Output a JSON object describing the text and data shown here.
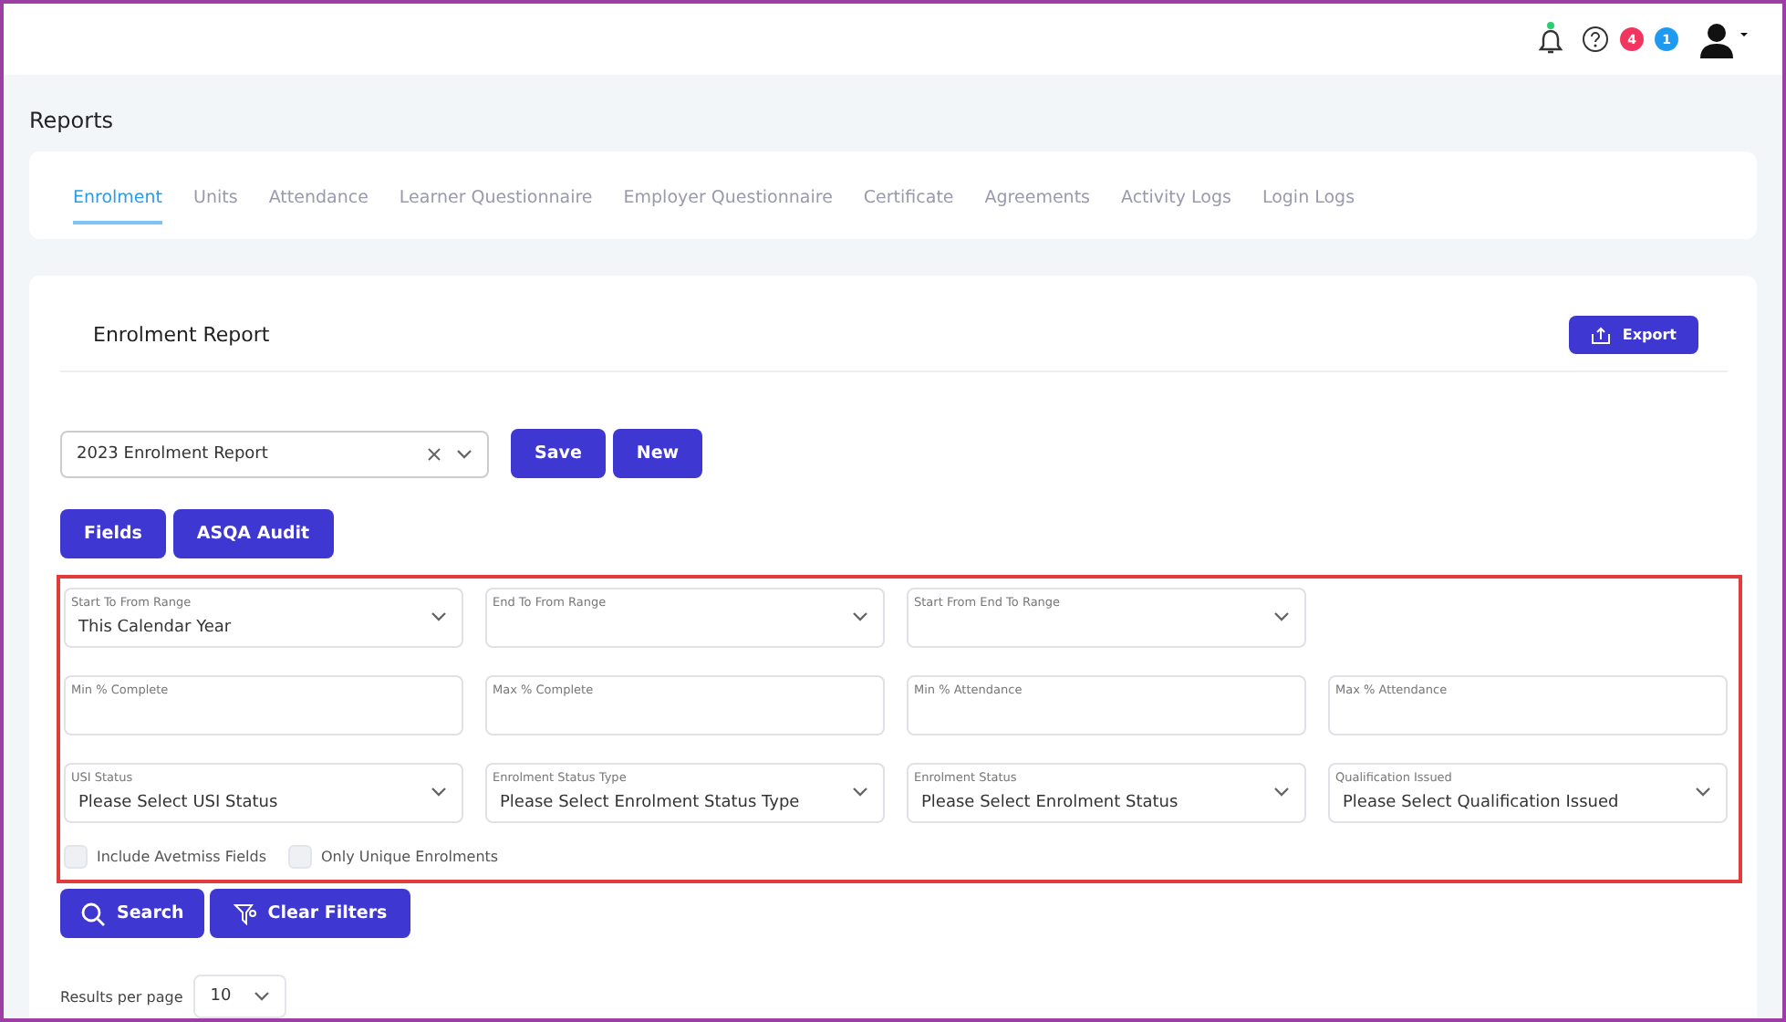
{
  "topbar": {
    "notification_dot": true,
    "badges": [
      {
        "count": "4",
        "color": "#f0365f"
      },
      {
        "count": "1",
        "color": "#1e9bf0"
      }
    ]
  },
  "page_title": "Reports",
  "tabs": [
    {
      "label": "Enrolment",
      "selected": true
    },
    {
      "label": "Units",
      "selected": false
    },
    {
      "label": "Attendance",
      "selected": false
    },
    {
      "label": "Learner Questionnaire",
      "selected": false
    },
    {
      "label": "Employer Questionnaire",
      "selected": false
    },
    {
      "label": "Certificate",
      "selected": false
    },
    {
      "label": "Agreements",
      "selected": false
    },
    {
      "label": "Activity Logs",
      "selected": false
    },
    {
      "label": "Login Logs",
      "selected": false
    }
  ],
  "report": {
    "title": "Enrolment Report",
    "export_button": "Export",
    "saved_report": {
      "value": "2023 Enrolment Report"
    },
    "save_buttons": [
      "Save",
      "New"
    ],
    "view_buttons": [
      "Fields",
      "ASQA Audit"
    ],
    "filter_rows": [
      [
        {
          "kind": "select",
          "label": "Start To From Range",
          "value": "This Calendar Year"
        },
        {
          "kind": "select",
          "label": "End To From Range"
        },
        {
          "kind": "select",
          "label": "Start From End To Range"
        }
      ],
      [
        {
          "kind": "input",
          "label": "Min % Complete"
        },
        {
          "kind": "input",
          "label": "Max % Complete"
        },
        {
          "kind": "input",
          "label": "Min % Attendance"
        },
        {
          "kind": "input",
          "label": "Max % Attendance"
        }
      ],
      [
        {
          "kind": "select",
          "label": "USI Status",
          "value": "Please Select USI Status"
        },
        {
          "kind": "select",
          "label": "Enrolment Status Type",
          "value": "Please Select Enrolment Status Type"
        },
        {
          "kind": "select",
          "label": "Enrolment Status",
          "value": "Please Select Enrolment Status"
        },
        {
          "kind": "select",
          "label": "Qualification Issued",
          "value": "Please Select Qualification Issued"
        }
      ]
    ],
    "checkboxes": [
      {
        "label": "Include Avetmiss Fields",
        "checked": false
      },
      {
        "label": "Only Unique Enrolments",
        "checked": false
      }
    ],
    "search_button": "Search",
    "clear_button": "Clear Filters",
    "results_per_page": {
      "label": "Results per page",
      "value": "10"
    }
  }
}
